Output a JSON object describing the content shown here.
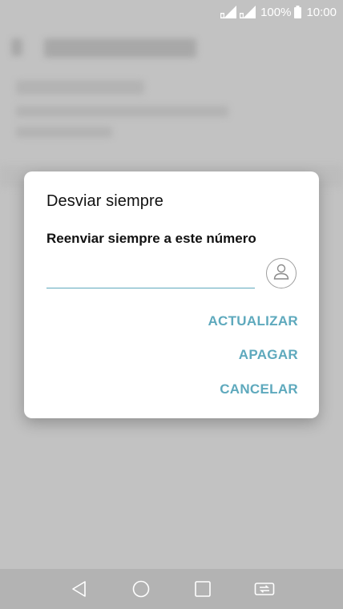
{
  "status_bar": {
    "battery_percent": "100%",
    "time": "10:00",
    "icons": [
      "signal-sim1-icon",
      "signal-sim2-icon",
      "battery-icon"
    ]
  },
  "dialog": {
    "title": "Desviar siempre",
    "label": "Reenviar siempre a este número",
    "input_value": "",
    "contact_icon": "contact-person-icon",
    "buttons": {
      "update": "ACTUALIZAR",
      "off": "APAGAR",
      "cancel": "CANCELAR"
    },
    "accent_color": "#5ea9bd"
  },
  "nav_bar": {
    "icons": [
      "back-icon",
      "home-icon",
      "recents-icon",
      "dual-window-icon"
    ]
  }
}
